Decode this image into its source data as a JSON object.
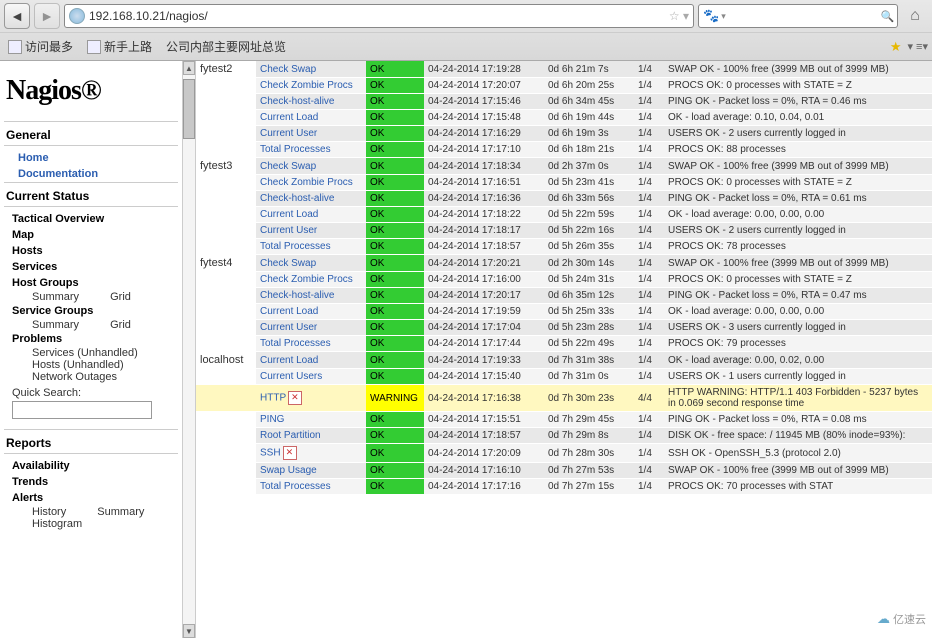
{
  "browser": {
    "url": "192.168.10.21/nagios/",
    "search_placeholder": "",
    "bookmarks": [
      "访问最多",
      "新手上路",
      "公司内部主要网址总览"
    ]
  },
  "sidebar": {
    "logo": "Nagios®",
    "general": {
      "header": "General",
      "home": "Home",
      "docs": "Documentation"
    },
    "current": {
      "header": "Current Status",
      "tactical": "Tactical Overview",
      "map": "Map",
      "hosts": "Hosts",
      "services": "Services",
      "hostgroups": "Host Groups",
      "hg_summary": "Summary",
      "hg_grid": "Grid",
      "servicegroups": "Service Groups",
      "sg_summary": "Summary",
      "sg_grid": "Grid",
      "problems": "Problems",
      "svc_unhandled": "Services (Unhandled)",
      "hosts_unhandled": "Hosts (Unhandled)",
      "outages": "Network Outages",
      "qs_label": "Quick Search:"
    },
    "reports": {
      "header": "Reports",
      "availability": "Availability",
      "trends": "Trends",
      "alerts": "Alerts",
      "history": "History",
      "summary": "Summary",
      "histogram": "Histogram"
    }
  },
  "services": [
    {
      "host": "fytest2",
      "svc": "Check Swap",
      "stat": "OK",
      "t": "04-24-2014 17:19:28",
      "d": "0d 6h 21m 7s",
      "a": "1/4",
      "info": "SWAP OK - 100% free (3999 MB out of 3999 MB)"
    },
    {
      "host": "",
      "svc": "Check Zombie Procs",
      "stat": "OK",
      "t": "04-24-2014 17:20:07",
      "d": "0d 6h 20m 25s",
      "a": "1/4",
      "info": "PROCS OK: 0 processes with STATE = Z"
    },
    {
      "host": "",
      "svc": "Check-host-alive",
      "stat": "OK",
      "t": "04-24-2014 17:15:46",
      "d": "0d 6h 34m 45s",
      "a": "1/4",
      "info": "PING OK - Packet loss = 0%, RTA = 0.46 ms"
    },
    {
      "host": "",
      "svc": "Current Load",
      "stat": "OK",
      "t": "04-24-2014 17:15:48",
      "d": "0d 6h 19m 44s",
      "a": "1/4",
      "info": "OK - load average: 0.10, 0.04, 0.01"
    },
    {
      "host": "",
      "svc": "Current User",
      "stat": "OK",
      "t": "04-24-2014 17:16:29",
      "d": "0d 6h 19m 3s",
      "a": "1/4",
      "info": "USERS OK - 2 users currently logged in"
    },
    {
      "host": "",
      "svc": "Total Processes",
      "stat": "OK",
      "t": "04-24-2014 17:17:10",
      "d": "0d 6h 18m 21s",
      "a": "1/4",
      "info": "PROCS OK: 88 processes"
    },
    {
      "host": "fytest3",
      "svc": "Check Swap",
      "stat": "OK",
      "t": "04-24-2014 17:18:34",
      "d": "0d 2h 37m 0s",
      "a": "1/4",
      "info": "SWAP OK - 100% free (3999 MB out of 3999 MB)"
    },
    {
      "host": "",
      "svc": "Check Zombie Procs",
      "stat": "OK",
      "t": "04-24-2014 17:16:51",
      "d": "0d 5h 23m 41s",
      "a": "1/4",
      "info": "PROCS OK: 0 processes with STATE = Z"
    },
    {
      "host": "",
      "svc": "Check-host-alive",
      "stat": "OK",
      "t": "04-24-2014 17:16:36",
      "d": "0d 6h 33m 56s",
      "a": "1/4",
      "info": "PING OK - Packet loss = 0%, RTA = 0.61 ms"
    },
    {
      "host": "",
      "svc": "Current Load",
      "stat": "OK",
      "t": "04-24-2014 17:18:22",
      "d": "0d 5h 22m 59s",
      "a": "1/4",
      "info": "OK - load average: 0.00, 0.00, 0.00"
    },
    {
      "host": "",
      "svc": "Current User",
      "stat": "OK",
      "t": "04-24-2014 17:18:17",
      "d": "0d 5h 22m 16s",
      "a": "1/4",
      "info": "USERS OK - 2 users currently logged in"
    },
    {
      "host": "",
      "svc": "Total Processes",
      "stat": "OK",
      "t": "04-24-2014 17:18:57",
      "d": "0d 5h 26m 35s",
      "a": "1/4",
      "info": "PROCS OK: 78 processes"
    },
    {
      "host": "fytest4",
      "svc": "Check Swap",
      "stat": "OK",
      "t": "04-24-2014 17:20:21",
      "d": "0d 2h 30m 14s",
      "a": "1/4",
      "info": "SWAP OK - 100% free (3999 MB out of 3999 MB)"
    },
    {
      "host": "",
      "svc": "Check Zombie Procs",
      "stat": "OK",
      "t": "04-24-2014 17:16:00",
      "d": "0d 5h 24m 31s",
      "a": "1/4",
      "info": "PROCS OK: 0 processes with STATE = Z"
    },
    {
      "host": "",
      "svc": "Check-host-alive",
      "stat": "OK",
      "t": "04-24-2014 17:20:17",
      "d": "0d 6h 35m 12s",
      "a": "1/4",
      "info": "PING OK - Packet loss = 0%, RTA = 0.47 ms"
    },
    {
      "host": "",
      "svc": "Current Load",
      "stat": "OK",
      "t": "04-24-2014 17:19:59",
      "d": "0d 5h 25m 33s",
      "a": "1/4",
      "info": "OK - load average: 0.00, 0.00, 0.00"
    },
    {
      "host": "",
      "svc": "Current User",
      "stat": "OK",
      "t": "04-24-2014 17:17:04",
      "d": "0d 5h 23m 28s",
      "a": "1/4",
      "info": "USERS OK - 3 users currently logged in"
    },
    {
      "host": "",
      "svc": "Total Processes",
      "stat": "OK",
      "t": "04-24-2014 17:17:44",
      "d": "0d 5h 22m 49s",
      "a": "1/4",
      "info": "PROCS OK: 79 processes"
    },
    {
      "host": "localhost",
      "svc": "Current Load",
      "stat": "OK",
      "t": "04-24-2014 17:19:33",
      "d": "0d 7h 31m 38s",
      "a": "1/4",
      "info": "OK - load average: 0.00, 0.02, 0.00"
    },
    {
      "host": "",
      "svc": "Current Users",
      "stat": "OK",
      "t": "04-24-2014 17:15:40",
      "d": "0d 7h 31m 0s",
      "a": "1/4",
      "info": "USERS OK - 1 users currently logged in"
    },
    {
      "host": "",
      "svc": "HTTP",
      "stat": "WARNING",
      "t": "04-24-2014 17:16:38",
      "d": "0d 7h 30m 23s",
      "a": "4/4",
      "info": "HTTP WARNING: HTTP/1.1 403 Forbidden - 5237 bytes in 0.069 second response time",
      "warn": true,
      "icon": true
    },
    {
      "host": "",
      "svc": "PING",
      "stat": "OK",
      "t": "04-24-2014 17:15:51",
      "d": "0d 7h 29m 45s",
      "a": "1/4",
      "info": "PING OK - Packet loss = 0%, RTA = 0.08 ms"
    },
    {
      "host": "",
      "svc": "Root Partition",
      "stat": "OK",
      "t": "04-24-2014 17:18:57",
      "d": "0d 7h 29m 8s",
      "a": "1/4",
      "info": "DISK OK - free space: / 11945 MB (80% inode=93%):"
    },
    {
      "host": "",
      "svc": "SSH",
      "stat": "OK",
      "t": "04-24-2014 17:20:09",
      "d": "0d 7h 28m 30s",
      "a": "1/4",
      "info": "SSH OK - OpenSSH_5.3 (protocol 2.0)",
      "icon": true
    },
    {
      "host": "",
      "svc": "Swap Usage",
      "stat": "OK",
      "t": "04-24-2014 17:16:10",
      "d": "0d 7h 27m 53s",
      "a": "1/4",
      "info": "SWAP OK - 100% free (3999 MB out of 3999 MB)"
    },
    {
      "host": "",
      "svc": "Total Processes",
      "stat": "OK",
      "t": "04-24-2014 17:17:16",
      "d": "0d 7h 27m 15s",
      "a": "1/4",
      "info": "PROCS OK: 70 processes with STAT"
    }
  ],
  "watermark": "亿速云"
}
